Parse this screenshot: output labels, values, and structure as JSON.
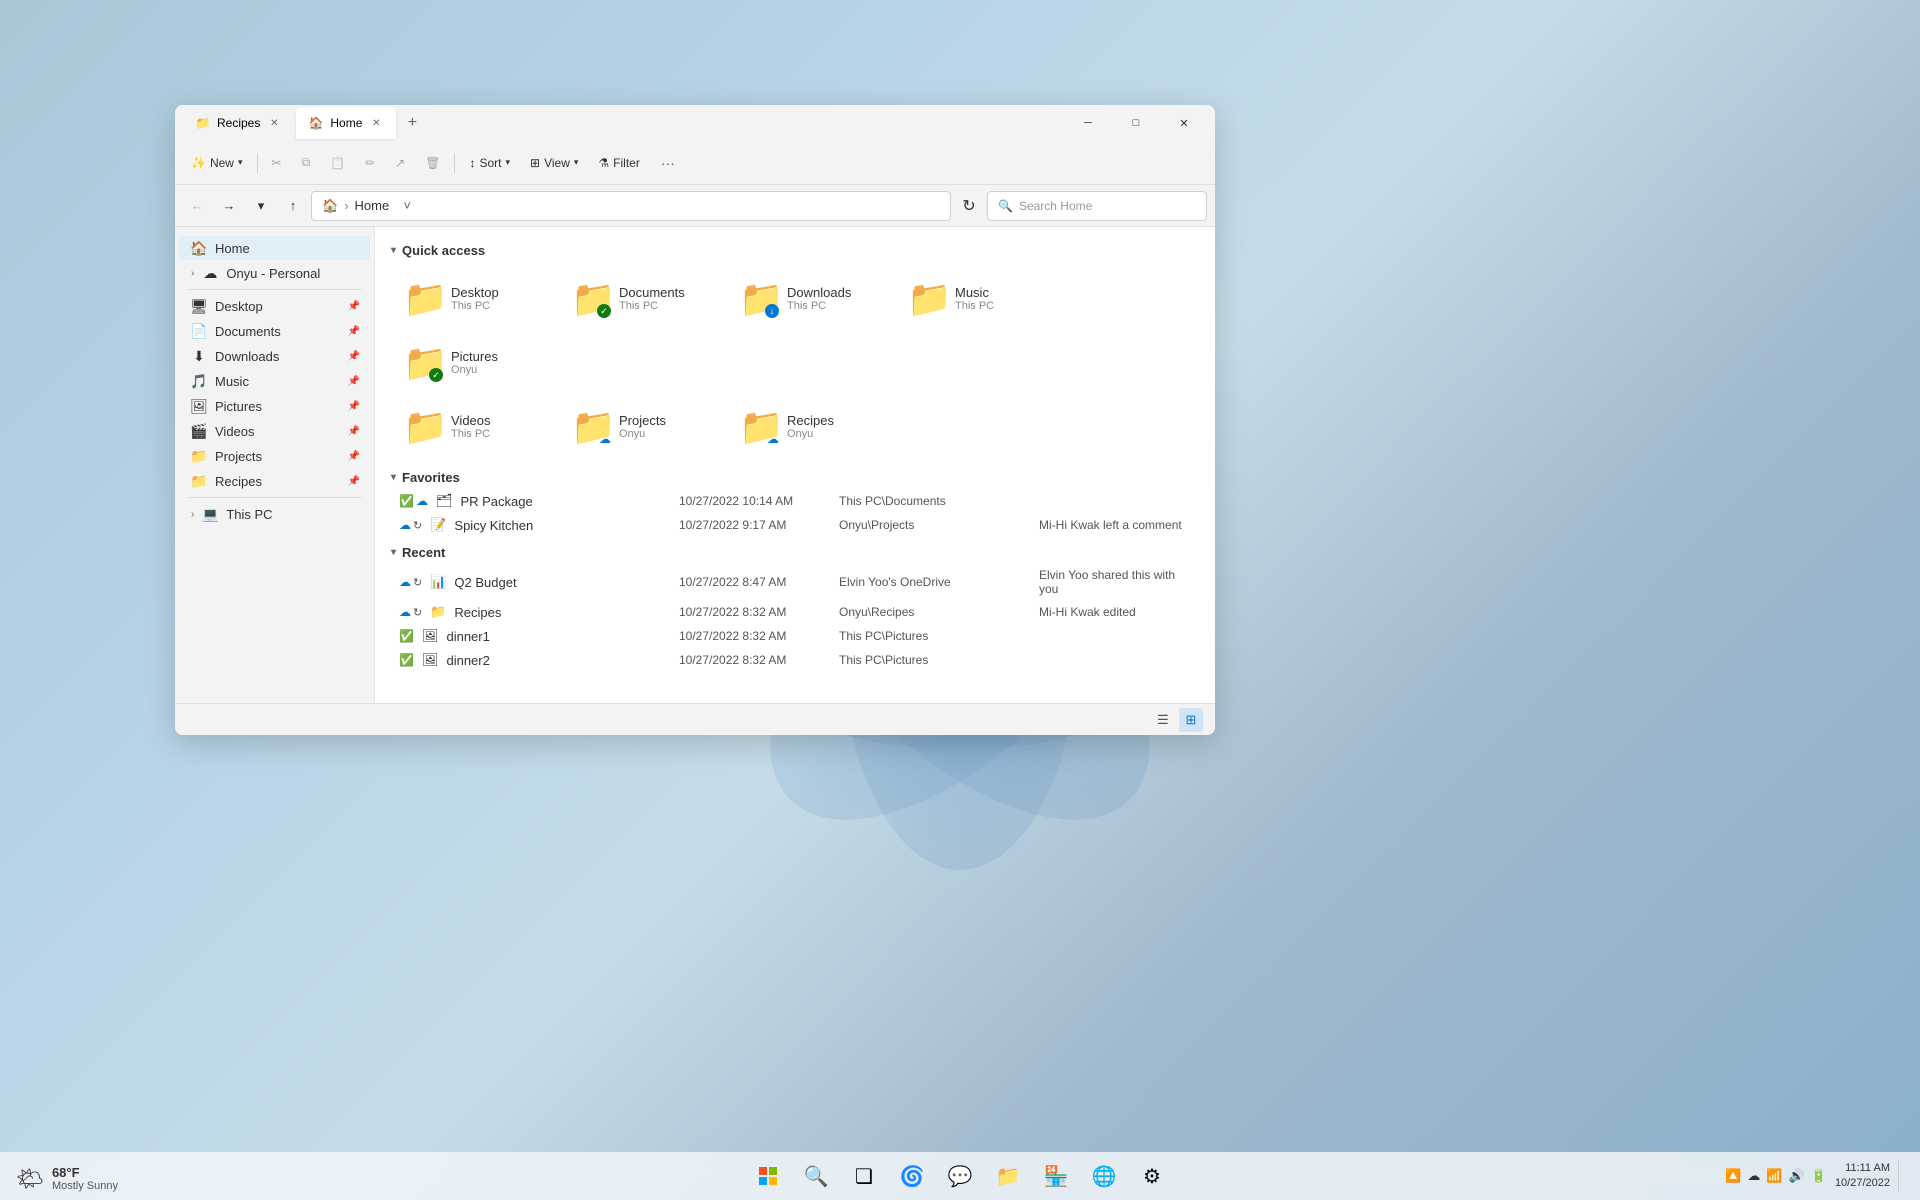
{
  "window": {
    "tabs": [
      {
        "label": "Recipes",
        "active": false,
        "icon": "📁"
      },
      {
        "label": "Home",
        "active": true,
        "icon": "🏠"
      }
    ],
    "add_tab": "+",
    "controls": {
      "minimize": "─",
      "maximize": "□",
      "close": "✕"
    }
  },
  "toolbar": {
    "new_label": "New",
    "cut_label": "✂",
    "copy_label": "⧉",
    "paste_label": "📋",
    "rename_label": "✏",
    "share_label": "↗",
    "delete_label": "🗑",
    "sort_label": "Sort",
    "view_label": "View",
    "filter_label": "Filter",
    "more_label": "···"
  },
  "address_bar": {
    "back": "←",
    "forward": "→",
    "recent": "▾",
    "up": "↑",
    "path_icon": "🏠",
    "path": "Home",
    "chevron": "˅",
    "refresh": "↻",
    "search_placeholder": "Search Home"
  },
  "sidebar": {
    "home_item": "Home",
    "onedrive_item": "Onyu - Personal",
    "items": [
      {
        "label": "Desktop",
        "icon": "🖥"
      },
      {
        "label": "Documents",
        "icon": "📄"
      },
      {
        "label": "Downloads",
        "icon": "⬇"
      },
      {
        "label": "Music",
        "icon": "🎵"
      },
      {
        "label": "Pictures",
        "icon": "🖼"
      },
      {
        "label": "Videos",
        "icon": "🎬"
      },
      {
        "label": "Projects",
        "icon": "📁"
      },
      {
        "label": "Recipes",
        "icon": "📁"
      }
    ],
    "this_pc": "This PC"
  },
  "quick_access": {
    "label": "Quick access",
    "items": [
      {
        "name": "Desktop",
        "sub": "This PC",
        "color": "blue",
        "badge": ""
      },
      {
        "name": "Documents",
        "sub": "This PC",
        "color": "blue",
        "badge": "✓"
      },
      {
        "name": "Downloads",
        "sub": "This PC",
        "color": "teal",
        "badge": ""
      },
      {
        "name": "Music",
        "sub": "This PC",
        "color": "red",
        "badge": ""
      },
      {
        "name": "Pictures",
        "sub": "Onyu",
        "color": "blue",
        "badge": "✓"
      },
      {
        "name": "Videos",
        "sub": "This PC",
        "color": "blue",
        "badge": ""
      },
      {
        "name": "Projects",
        "sub": "Onyu",
        "color": "yellow",
        "badge": "☁"
      },
      {
        "name": "Recipes",
        "sub": "Onyu",
        "color": "yellow",
        "badge": "☁"
      }
    ]
  },
  "favorites": {
    "label": "Favorites",
    "items": [
      {
        "name": "PR Package",
        "date": "10/27/2022 10:14 AM",
        "location": "This PC\\Documents",
        "activity": "",
        "status": "check-cloud"
      },
      {
        "name": "Spicy Kitchen",
        "date": "10/27/2022 9:17 AM",
        "location": "Onyu\\Projects",
        "activity": "Mi-Hi Kwak left a comment",
        "status": "cloud"
      }
    ]
  },
  "recent": {
    "label": "Recent",
    "items": [
      {
        "name": "Q2 Budget",
        "date": "10/27/2022 8:47 AM",
        "location": "Elvin Yoo's OneDrive",
        "activity": "Elvin Yoo shared this with you",
        "status": "cloud"
      },
      {
        "name": "Recipes",
        "date": "10/27/2022 8:32 AM",
        "location": "Onyu\\Recipes",
        "activity": "Mi-Hi Kwak edited",
        "status": "cloud"
      },
      {
        "name": "dinner1",
        "date": "10/27/2022 8:32 AM",
        "location": "This PC\\Pictures",
        "activity": "",
        "status": "check"
      },
      {
        "name": "dinner2",
        "date": "10/27/2022 8:32 AM",
        "location": "This PC\\Pictures",
        "activity": "",
        "status": "check"
      }
    ]
  },
  "bottom_bar": {
    "list_view": "☰",
    "grid_view": "⊞"
  },
  "taskbar": {
    "start": "⊞",
    "search": "🔍",
    "task_view": "❏",
    "widgets": "🌀",
    "store": "🏪",
    "edge": "🌐",
    "settings": "⚙",
    "icons": [
      "🔼",
      "☁",
      "📶",
      "🔊",
      "🔋"
    ],
    "time": "11:11 AM",
    "date": "10/27/2022"
  },
  "weather": {
    "icon": "🌤",
    "temp": "68°F",
    "desc": "Mostly Sunny"
  }
}
